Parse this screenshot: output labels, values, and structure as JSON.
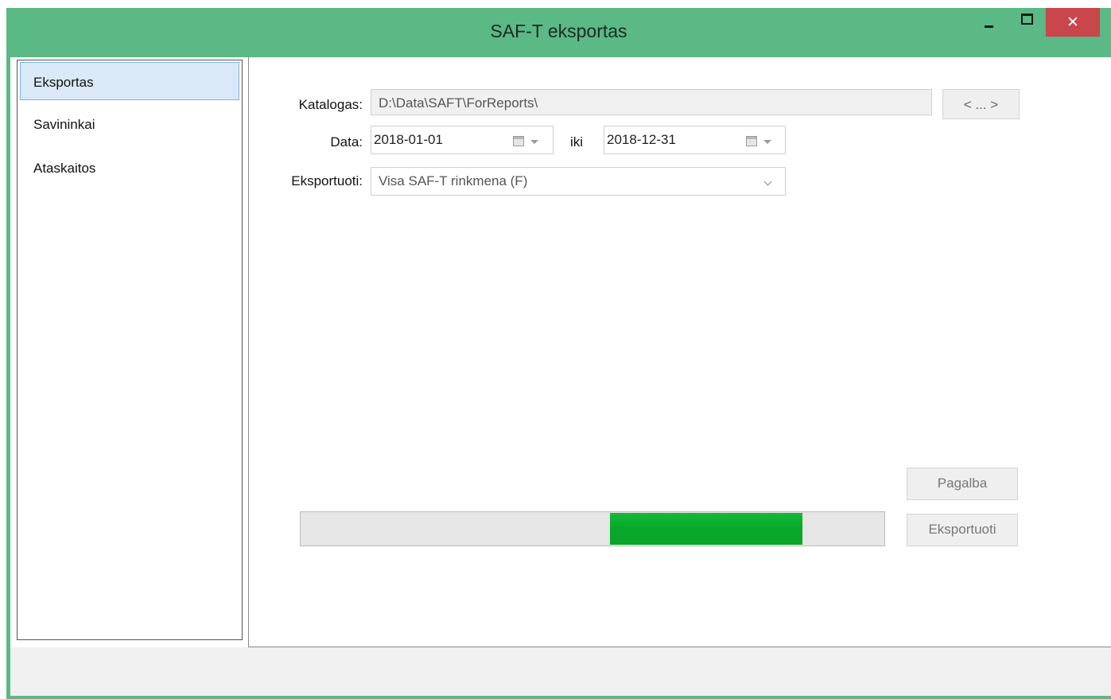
{
  "window": {
    "title": "SAF-T eksportas",
    "controls": {
      "minimize": "minimize",
      "maximize": "maximize",
      "close": "✕"
    }
  },
  "colors": {
    "frame": "#5ab985",
    "close_button": "#c9464a",
    "progress": "#06a829",
    "selection": "#d9e9f8"
  },
  "sidebar": {
    "items": [
      {
        "label": "Eksportas",
        "active": true
      },
      {
        "label": "Savininkai",
        "active": false
      },
      {
        "label": "Ataskaitos",
        "active": false
      }
    ]
  },
  "form": {
    "catalog": {
      "label": "Katalogas:",
      "value": "D:\\Data\\SAFT\\ForReports\\",
      "browse_label": "< ... >"
    },
    "date": {
      "label": "Data:",
      "from": "2018-01-01",
      "to_label": "iki",
      "to": "2018-12-31",
      "calendar_icon": "calendar-icon"
    },
    "export": {
      "label": "Eksportuoti:",
      "selected": "Visa SAF-T rinkmena (F)"
    }
  },
  "actions": {
    "help_label": "Pagalba",
    "export_label": "Eksportuoti"
  },
  "progress": {
    "segment_start": 0.53,
    "segment_end": 0.86
  }
}
